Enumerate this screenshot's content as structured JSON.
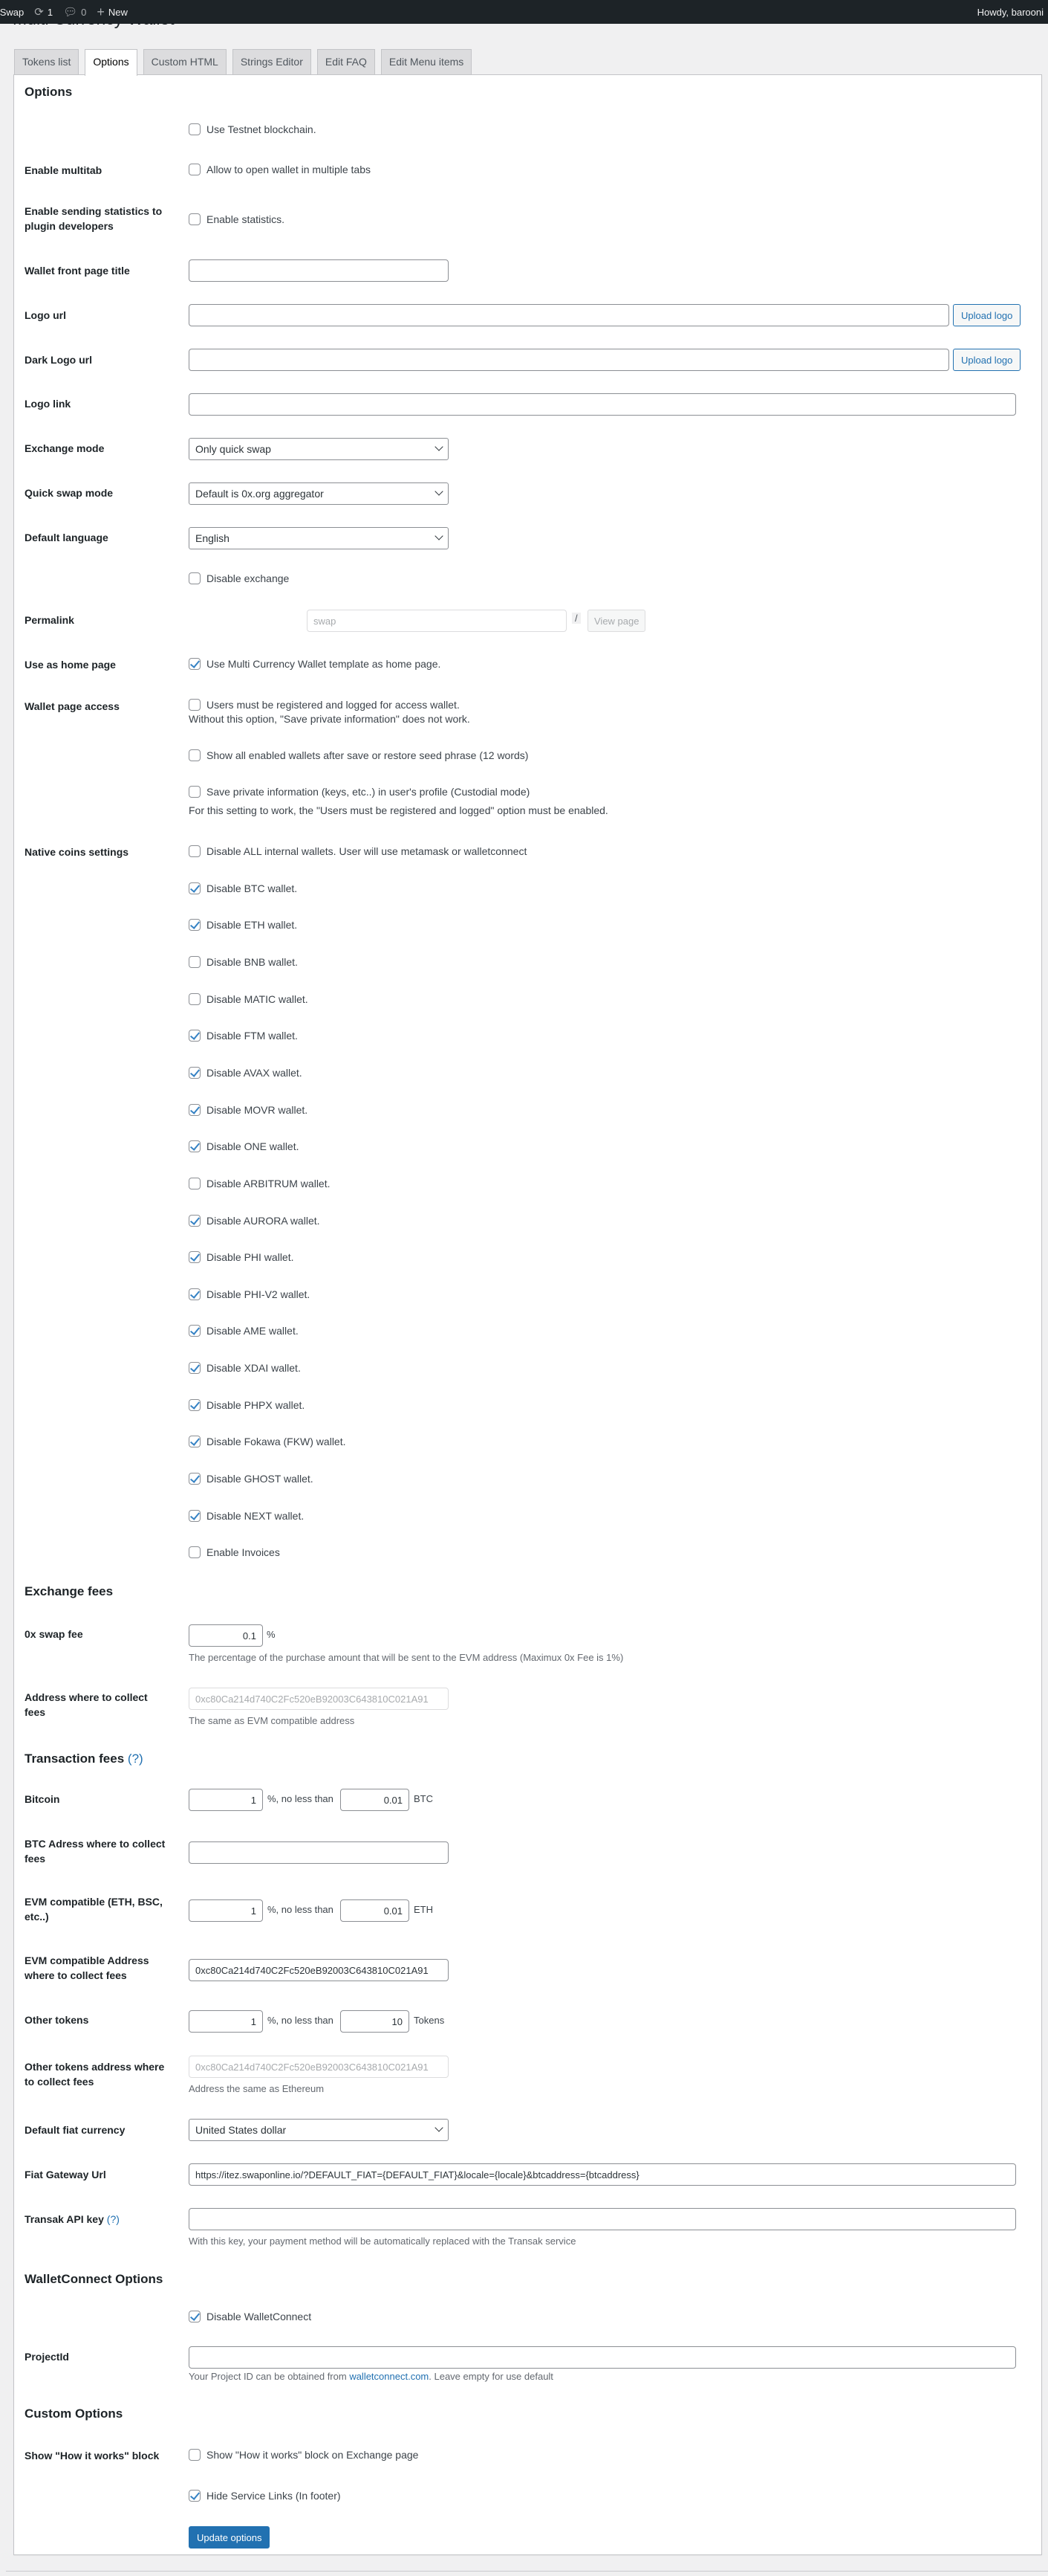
{
  "adminbar": {
    "site_name": "al Swap",
    "updates_count": "1",
    "comments_count": "0",
    "new_label": "New",
    "howdy": "Howdy, barooni"
  },
  "page_title": "Multi Currency Wallet",
  "tabs": [
    {
      "label": "Tokens list",
      "active": false
    },
    {
      "label": "Options",
      "active": true
    },
    {
      "label": "Custom HTML",
      "active": false
    },
    {
      "label": "Strings Editor",
      "active": false
    },
    {
      "label": "Edit FAQ",
      "active": false
    },
    {
      "label": "Edit Menu items",
      "active": false
    }
  ],
  "options": {
    "heading": "Options",
    "testnet": {
      "label": "Use Testnet blockchain.",
      "checked": false
    },
    "multitab": {
      "row_label": "Enable multitab",
      "label": "Allow to open wallet in multiple tabs",
      "checked": false
    },
    "statistics": {
      "row_label": "Enable sending statistics to plugin developers",
      "label": "Enable statistics.",
      "checked": false
    },
    "front_title": {
      "row_label": "Wallet front page title",
      "value": ""
    },
    "logo_url": {
      "row_label": "Logo url",
      "value": "",
      "button": "Upload logo"
    },
    "dark_logo_url": {
      "row_label": "Dark Logo url",
      "value": "",
      "button": "Upload logo"
    },
    "logo_link": {
      "row_label": "Logo link",
      "value": ""
    },
    "exchange_mode": {
      "row_label": "Exchange mode",
      "selected": "Only quick swap"
    },
    "quick_swap_mode": {
      "row_label": "Quick swap mode",
      "selected": "Default is 0x.org aggregator"
    },
    "default_language": {
      "row_label": "Default language",
      "selected": "English"
    },
    "disable_exchange": {
      "label": "Disable exchange",
      "checked": false
    },
    "permalink": {
      "row_label": "Permalink",
      "value": "swap",
      "slash": "/",
      "view_button": "View page"
    },
    "home_page": {
      "row_label": "Use as home page",
      "label": "Use Multi Currency Wallet template as home page.",
      "checked": true
    },
    "wallet_access": {
      "row_label": "Wallet page access",
      "registered": {
        "label": "Users must be registered and logged for access wallet.",
        "checked": false,
        "note": "Without this option, \"Save private information\" does not work."
      },
      "show_all": {
        "label": "Show all enabled wallets after save or restore seed phrase (12 words)",
        "checked": false
      },
      "save_private": {
        "label": "Save private information (keys, etc..) in user's profile (Custodial mode)",
        "checked": false,
        "note": "For this setting to work, the \"Users must be registered and logged\" option must be enabled."
      }
    },
    "native_coins": {
      "row_label": "Native coins settings",
      "items": [
        {
          "label": "Disable ALL internal wallets. User will use metamask or walletconnect",
          "checked": false
        },
        {
          "label": "Disable BTC wallet.",
          "checked": true
        },
        {
          "label": "Disable ETH wallet.",
          "checked": true
        },
        {
          "label": "Disable BNB wallet.",
          "checked": false
        },
        {
          "label": "Disable MATIC wallet.",
          "checked": false
        },
        {
          "label": "Disable FTM wallet.",
          "checked": true
        },
        {
          "label": "Disable AVAX wallet.",
          "checked": true
        },
        {
          "label": "Disable MOVR wallet.",
          "checked": true
        },
        {
          "label": "Disable ONE wallet.",
          "checked": true
        },
        {
          "label": "Disable ARBITRUM wallet.",
          "checked": false
        },
        {
          "label": "Disable AURORA wallet.",
          "checked": true
        },
        {
          "label": "Disable PHI wallet.",
          "checked": true
        },
        {
          "label": "Disable PHI-V2 wallet.",
          "checked": true
        },
        {
          "label": "Disable AME wallet.",
          "checked": true
        },
        {
          "label": "Disable XDAI wallet.",
          "checked": true
        },
        {
          "label": "Disable PHPX wallet.",
          "checked": true
        },
        {
          "label": "Disable Fokawa (FKW) wallet.",
          "checked": true
        },
        {
          "label": "Disable GHOST wallet.",
          "checked": true
        },
        {
          "label": "Disable NEXT wallet.",
          "checked": true
        },
        {
          "label": "Enable Invoices",
          "checked": false
        }
      ]
    }
  },
  "exchange_fees": {
    "heading": "Exchange fees",
    "swap_fee": {
      "row_label": "0x swap fee",
      "value": "0.1",
      "unit": "%",
      "note": "The percentage of the purchase amount that will be sent to the EVM address (Maximux 0x Fee is 1%)"
    },
    "collect_address": {
      "row_label": "Address where to collect fees",
      "value": "0xc80Ca214d740C2Fc520eB92003C643810C021A91",
      "note": "The same as EVM compatible address"
    }
  },
  "transaction_fees": {
    "heading": "Transaction fees",
    "help": "(?)",
    "bitcoin": {
      "row_label": "Bitcoin",
      "percent": "1",
      "middle": "%, no less than",
      "min": "0.01",
      "unit": "BTC"
    },
    "btc_address": {
      "row_label": "BTC Adress where to collect fees",
      "value": ""
    },
    "evm": {
      "row_label": "EVM compatible (ETH, BSC, etc..)",
      "percent": "1",
      "middle": "%, no less than",
      "min": "0.01",
      "unit": "ETH"
    },
    "evm_address": {
      "row_label": "EVM compatible Address where to collect fees",
      "value": "0xc80Ca214d740C2Fc520eB92003C643810C021A91"
    },
    "other_tokens": {
      "row_label": "Other tokens",
      "percent": "1",
      "middle": "%, no less than",
      "min": "10",
      "unit": "Tokens"
    },
    "other_address": {
      "row_label": "Other tokens address where to collect fees",
      "value": "0xc80Ca214d740C2Fc520eB92003C643810C021A91",
      "note": "Address the same as Ethereum"
    },
    "fiat_currency": {
      "row_label": "Default fiat currency",
      "selected": "United States dollar"
    },
    "fiat_gateway": {
      "row_label": "Fiat Gateway Url",
      "value": "https://itez.swaponline.io/?DEFAULT_FIAT={DEFAULT_FIAT}&locale={locale}&btcaddress={btcaddress}"
    },
    "transak": {
      "row_label": "Transak API key",
      "help": "(?)",
      "value": "",
      "note": "With this key, your payment method will be automatically replaced with the Transak service"
    }
  },
  "walletconnect": {
    "heading": "WalletConnect Options",
    "disable": {
      "label": "Disable WalletConnect",
      "checked": true
    },
    "project_id": {
      "row_label": "ProjectId",
      "value": "",
      "note_before": "Your Project ID can be obtained from ",
      "note_link": "walletconnect.com",
      "note_after": ". Leave empty for use default"
    }
  },
  "custom": {
    "heading": "Custom Options",
    "how_it_works": {
      "row_label": "Show \"How it works\" block",
      "label": "Show \"How it works\" block on Exchange page",
      "checked": false
    },
    "hide_links": {
      "label": "Hide Service Links (In footer)",
      "checked": true
    }
  },
  "submit_label": "Update options",
  "colors": {
    "accent": "#2271b1",
    "adminbar": "#1d2327",
    "background": "#f0f0f1"
  }
}
